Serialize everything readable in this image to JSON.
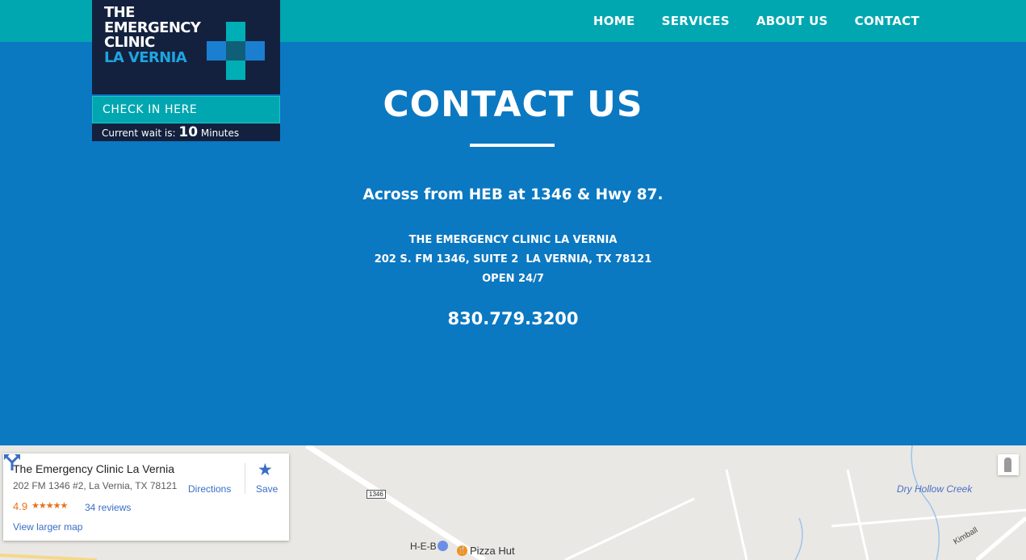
{
  "logo": {
    "line1": "THE",
    "line2": "EMERGENCY",
    "line3": "CLINIC",
    "line4": "LA VERNIA"
  },
  "nav": {
    "items": [
      {
        "label": "HOME"
      },
      {
        "label": "SERVICES"
      },
      {
        "label": "ABOUT US"
      },
      {
        "label": "CONTACT"
      }
    ]
  },
  "checkin": {
    "label": "CHECK IN HERE",
    "wait_prefix": "Current wait is:",
    "wait_value": "10",
    "wait_unit": "Minutes"
  },
  "contact": {
    "title": "CONTACT US",
    "location_note": "Across from HEB at 1346 & Hwy 87.",
    "name": "THE EMERGENCY CLINIC LA VERNIA",
    "address": "202 S. FM 1346, SUITE 2  LA VERNIA, TX 78121",
    "hours": "OPEN 24/7",
    "phone": "830.779.3200"
  },
  "map": {
    "card": {
      "name": "The Emergency Clinic La Vernia",
      "address": "202 FM 1346 #2, La Vernia, TX 78121",
      "rating": "4.9",
      "stars": "★★★★★",
      "reviews": "34 reviews",
      "directions": "Directions",
      "save": "Save",
      "larger_map": "View larger map"
    },
    "labels": {
      "route": "1346",
      "heb": "H-E-B",
      "pizza": "Pizza Hut",
      "creek": "Dry Hollow Creek",
      "kimball": "Kimball"
    },
    "colors": {
      "road": "#ffffff",
      "water": "#9ec4ec",
      "land": "#e9e8e4"
    }
  },
  "colors": {
    "teal": "#00a7b1",
    "blue": "#0b78c2",
    "navy": "#13213f",
    "accent_blue": "#1ea5e0"
  }
}
